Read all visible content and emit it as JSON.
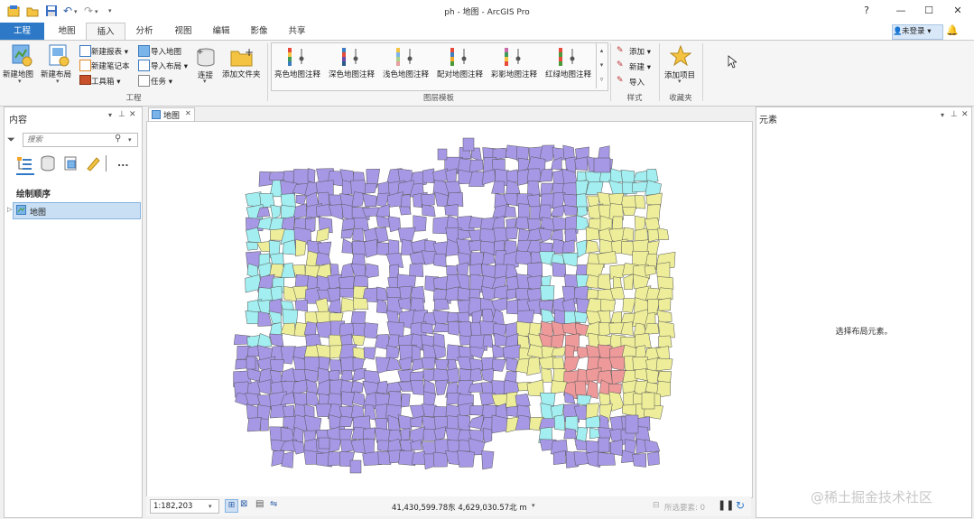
{
  "window": {
    "title": "ph - 地图 - ArcGIS Pro",
    "help": "?",
    "minimize": "—",
    "maximize": "☐",
    "close": "✕"
  },
  "tabs": {
    "file": "工程",
    "items": [
      "地图",
      "插入",
      "分析",
      "视图",
      "编辑",
      "影像",
      "共享"
    ],
    "active": "插入"
  },
  "user": {
    "label": "未登录 ▾"
  },
  "ribbon": {
    "project_group": {
      "new_map": "新建地图",
      "new_layout": "新建布局",
      "new_report": "新建报表 ▾",
      "new_notebook": "新建笔记本",
      "toolbox": "工具箱 ▾",
      "import_map": "导入地图",
      "import_layout": "导入布局 ▾",
      "task": "任务 ▾",
      "connect": "连接",
      "add_folder": "添加文件夹",
      "label": "工程"
    },
    "layer_templates": {
      "items": [
        "亮色地图注释",
        "深色地图注释",
        "浅色地图注释",
        "配对地图注释",
        "彩影地图注释",
        "红绿地图注释"
      ],
      "label": "图层模板"
    },
    "styles": {
      "add": "添加 ▾",
      "new": "新建 ▾",
      "import": "导入",
      "label": "样式"
    },
    "favorites": {
      "add_item": "添加项目",
      "label": "收藏夹"
    }
  },
  "contents_pane": {
    "title": "内容",
    "search_placeholder": "搜索",
    "drawing_order": "绘制顺序",
    "map_item": "地图",
    "more": "..."
  },
  "map_tab": {
    "label": "地图"
  },
  "elements_pane": {
    "title": "元素",
    "message": "选择布局元素。"
  },
  "status": {
    "scale": "1:182,203",
    "coordinates": "41,430,599.78东 4,629,030.57北 m",
    "selected": "所选要素: 0"
  },
  "watermark": "@稀土掘金技术社区",
  "colors": {
    "purple": "#a798e6",
    "cyan": "#a2eef0",
    "yellow": "#eeee9a",
    "red": "#ee9a9a",
    "accent": "#2d79c7"
  }
}
